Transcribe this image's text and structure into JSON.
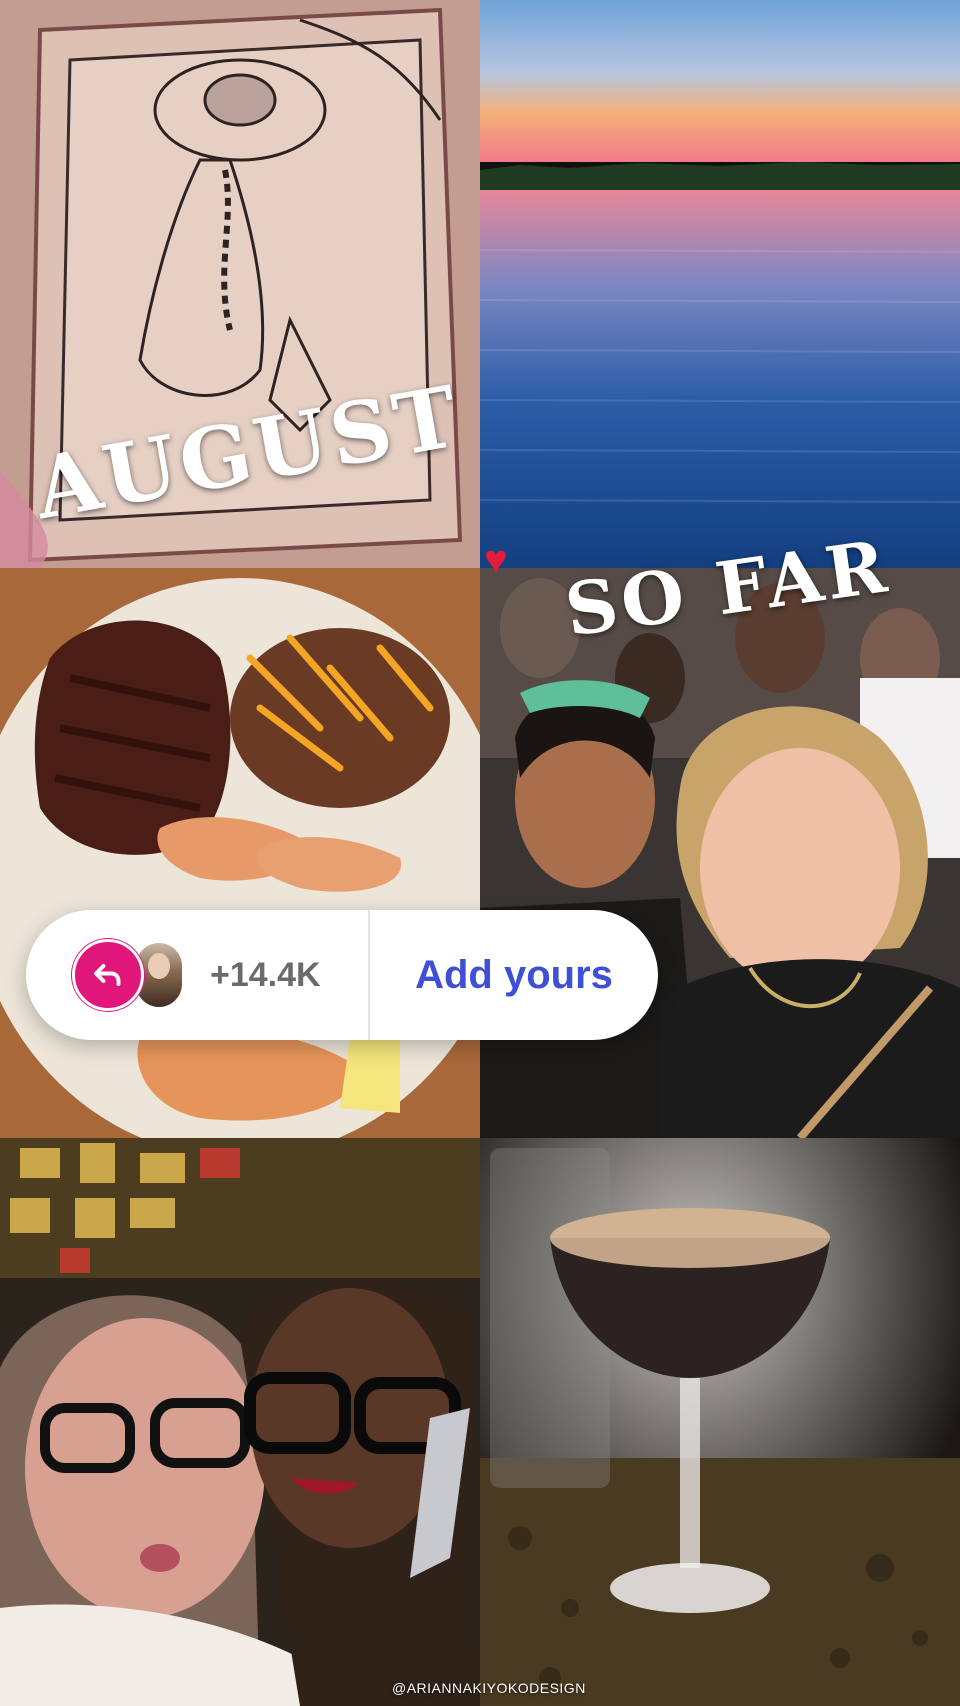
{
  "story": {
    "headline_left": "AUGUST",
    "headline_right": "SO FAR",
    "heart_icon": "heart-icon"
  },
  "add_yours_sticker": {
    "count": "+14.4K",
    "button_label": "Add yours",
    "icon": "reply-arrow-icon",
    "accent_color": "#e0167a",
    "label_color": "#3f4fd6"
  },
  "credit": {
    "handle": "@ARIANNAKIYOKODESIGN"
  },
  "photos": [
    "tattoo-photo",
    "sunset-lake-photo",
    "steak-dinner-photo",
    "concert-selfie-photo",
    "friends-selfie-photo",
    "espresso-martini-photo"
  ]
}
